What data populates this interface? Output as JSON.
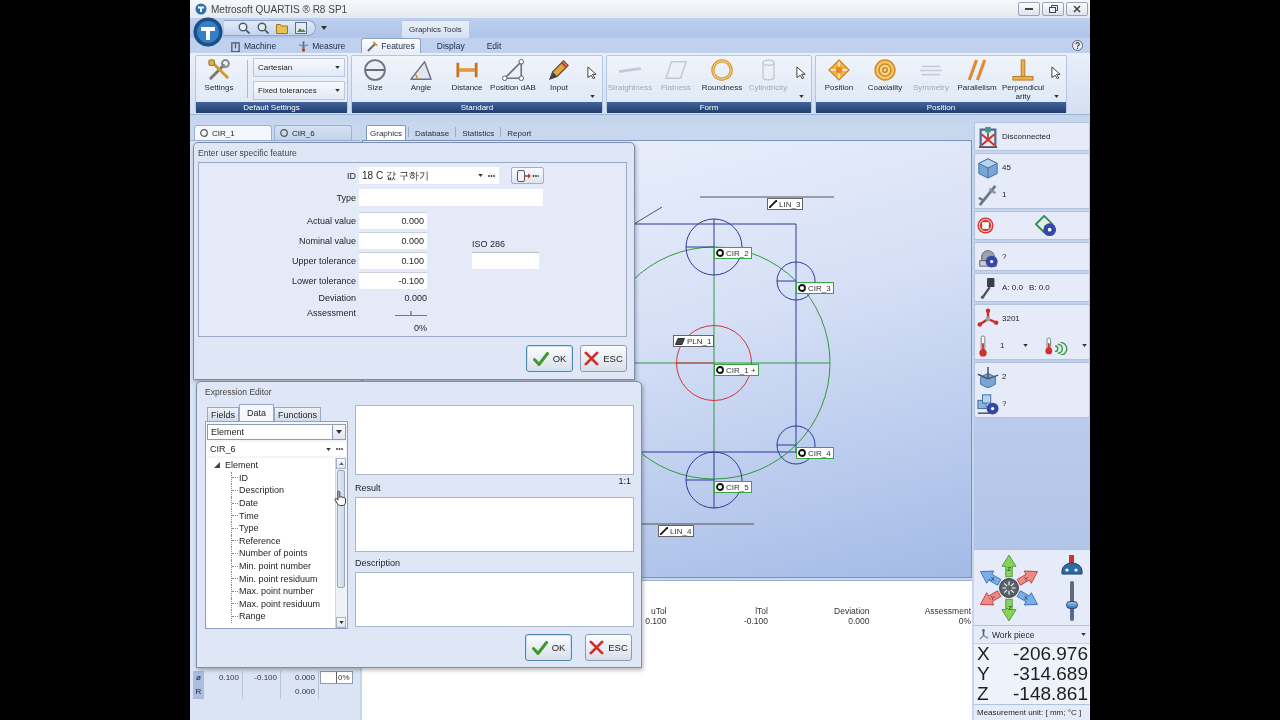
{
  "window": {
    "title": "Metrosoft QUARTIS ® R8 SP1"
  },
  "ribbon": {
    "contextual_group": "Graphics Tools",
    "tabs": [
      {
        "label": "Machine",
        "selected": false
      },
      {
        "label": "Measure",
        "selected": false
      },
      {
        "label": "Features",
        "selected": true
      },
      {
        "label": "Display",
        "selected": false
      },
      {
        "label": "Edit",
        "selected": false
      }
    ],
    "groups": [
      {
        "kind": "settings",
        "title": "Default Settings",
        "button": "Settings",
        "dropdowns": [
          "Cartesian",
          "Fixed tolerances"
        ]
      },
      {
        "kind": "tools",
        "title": "Standard",
        "items": [
          {
            "label": "Size",
            "disabled": false
          },
          {
            "label": "Angle",
            "disabled": false
          },
          {
            "label": "Distance",
            "disabled": false
          },
          {
            "label": "Position dAB",
            "disabled": false
          },
          {
            "label": "Input",
            "disabled": false
          }
        ]
      },
      {
        "kind": "tools",
        "title": "Form",
        "items": [
          {
            "label": "Straightness",
            "disabled": true
          },
          {
            "label": "Flatness",
            "disabled": true
          },
          {
            "label": "Roundness",
            "disabled": false
          },
          {
            "label": "Cylindricity",
            "disabled": true
          }
        ]
      },
      {
        "kind": "tools",
        "title": "Position",
        "items": [
          {
            "label": "Position",
            "disabled": false
          },
          {
            "label": "Coaxiality",
            "disabled": false
          },
          {
            "label": "Symmetry",
            "disabled": true
          },
          {
            "label": "Parallelism",
            "disabled": false
          },
          {
            "label": "Perpendicularity",
            "disabled": false
          }
        ]
      }
    ]
  },
  "feature_tabs": [
    {
      "label": "CIR_1",
      "selected": true
    },
    {
      "label": "CIR_6",
      "selected": false
    }
  ],
  "view_tabs": [
    {
      "label": "Graphics",
      "selected": true
    },
    {
      "label": "Database",
      "selected": false
    },
    {
      "label": "Statistics",
      "selected": false
    },
    {
      "label": "Report",
      "selected": false
    }
  ],
  "graphics": {
    "labels": [
      {
        "kind": "line",
        "text": "LIN_3"
      },
      {
        "kind": "circle",
        "text": "CIR_2"
      },
      {
        "kind": "circle",
        "text": "CIR_3"
      },
      {
        "kind": "plane",
        "text": "PLN_1"
      },
      {
        "kind": "circle",
        "text": "CIR_1 +"
      },
      {
        "kind": "circle",
        "text": "CIR_4"
      },
      {
        "kind": "circle",
        "text": "CIR_5"
      },
      {
        "kind": "line",
        "text": "LIN_4"
      }
    ]
  },
  "results": {
    "columns": [
      {
        "label": "uTol",
        "value": "0.100"
      },
      {
        "label": "lTol",
        "value": "-0.100"
      },
      {
        "label": "Deviation",
        "value": "0.000"
      },
      {
        "label": "Assessment",
        "value": "0%"
      }
    ]
  },
  "feature_table": {
    "rows": [
      {
        "column_1": "ø",
        "column_2": "0.100",
        "column_3": "-0.100",
        "column_4": "0.000",
        "column_5": "0%"
      },
      {
        "column_1": "R",
        "column_4": "0.000"
      }
    ]
  },
  "machine_panel": {
    "sections": [
      {
        "rows": [
          {
            "kind": "status",
            "text": "Disconnected"
          }
        ]
      },
      {
        "rows": [
          {
            "kind": "status",
            "text": "45"
          },
          {
            "kind": "status",
            "text": "1"
          }
        ]
      },
      {
        "rows": [
          {
            "kind": "tools"
          }
        ]
      },
      {
        "rows": [
          {
            "kind": "status",
            "text": "?"
          }
        ]
      },
      {
        "rows": [
          {
            "kind": "angles",
            "texts": [
              "A: 0.0",
              "B: 0.0"
            ]
          }
        ]
      },
      {
        "rows": [
          {
            "kind": "status",
            "text": "3201"
          },
          {
            "kind": "temperature",
            "text": "1"
          }
        ]
      },
      {
        "rows": [
          {
            "kind": "status",
            "text": "2"
          },
          {
            "kind": "status",
            "text": "?"
          }
        ]
      }
    ],
    "jog_arrows": [
      "Z",
      "-X",
      "Y",
      "-Y",
      "X",
      "-Z"
    ],
    "speed_slider": {
      "level": 0.35
    },
    "coordinate_system": "Work piece",
    "coordinates": [
      {
        "axis": "X",
        "value": "-206.976"
      },
      {
        "axis": "Y",
        "value": "-314.689"
      },
      {
        "axis": "Z",
        "value": "-148.861"
      }
    ],
    "unit": "Measurement unit: [ mm; °C ]"
  },
  "feature_dialog": {
    "title": "Enter user specific feature",
    "id": {
      "label": "ID",
      "value": "18 C 값 구하기"
    },
    "type": {
      "label": "Type"
    },
    "fields": [
      {
        "label": "Actual value",
        "value": "0.000"
      },
      {
        "label": "Nominal value",
        "value": "0.000"
      },
      {
        "label": "Upper tolerance",
        "value": "0.100"
      },
      {
        "label": "Lower tolerance",
        "value": "-0.100"
      }
    ],
    "iso": {
      "label": "ISO 286"
    },
    "deviation": {
      "label": "Deviation",
      "value": "0.000"
    },
    "assessment": {
      "label": "Assessment",
      "value": "0%"
    },
    "buttons": [
      {
        "kind": "ok",
        "label": "OK"
      },
      {
        "kind": "esc",
        "label": "ESC"
      }
    ]
  },
  "expression_editor": {
    "title": "Expression Editor",
    "tabs": [
      {
        "label": "Fields",
        "selected": false
      },
      {
        "label": "Data",
        "selected": true
      },
      {
        "label": "Functions",
        "selected": false
      }
    ],
    "category": "Element",
    "element": "CIR_6",
    "tree": [
      {
        "label": "Element",
        "expanded": true,
        "children": [
          {
            "label": "ID"
          },
          {
            "label": "Description"
          },
          {
            "label": "Date"
          },
          {
            "label": "Time"
          },
          {
            "label": "Type"
          },
          {
            "label": "Reference"
          },
          {
            "label": "Number of points"
          },
          {
            "label": "Min. point number"
          },
          {
            "label": "Min. point residuum"
          },
          {
            "label": "Max. point number"
          },
          {
            "label": "Max. point residuum"
          },
          {
            "label": "Range"
          }
        ]
      }
    ],
    "ratio": "1:1",
    "sections": [
      {
        "label": "Result"
      },
      {
        "label": "Description"
      }
    ],
    "buttons": [
      {
        "kind": "ok",
        "label": "OK"
      },
      {
        "kind": "esc",
        "label": "ESC"
      }
    ]
  }
}
